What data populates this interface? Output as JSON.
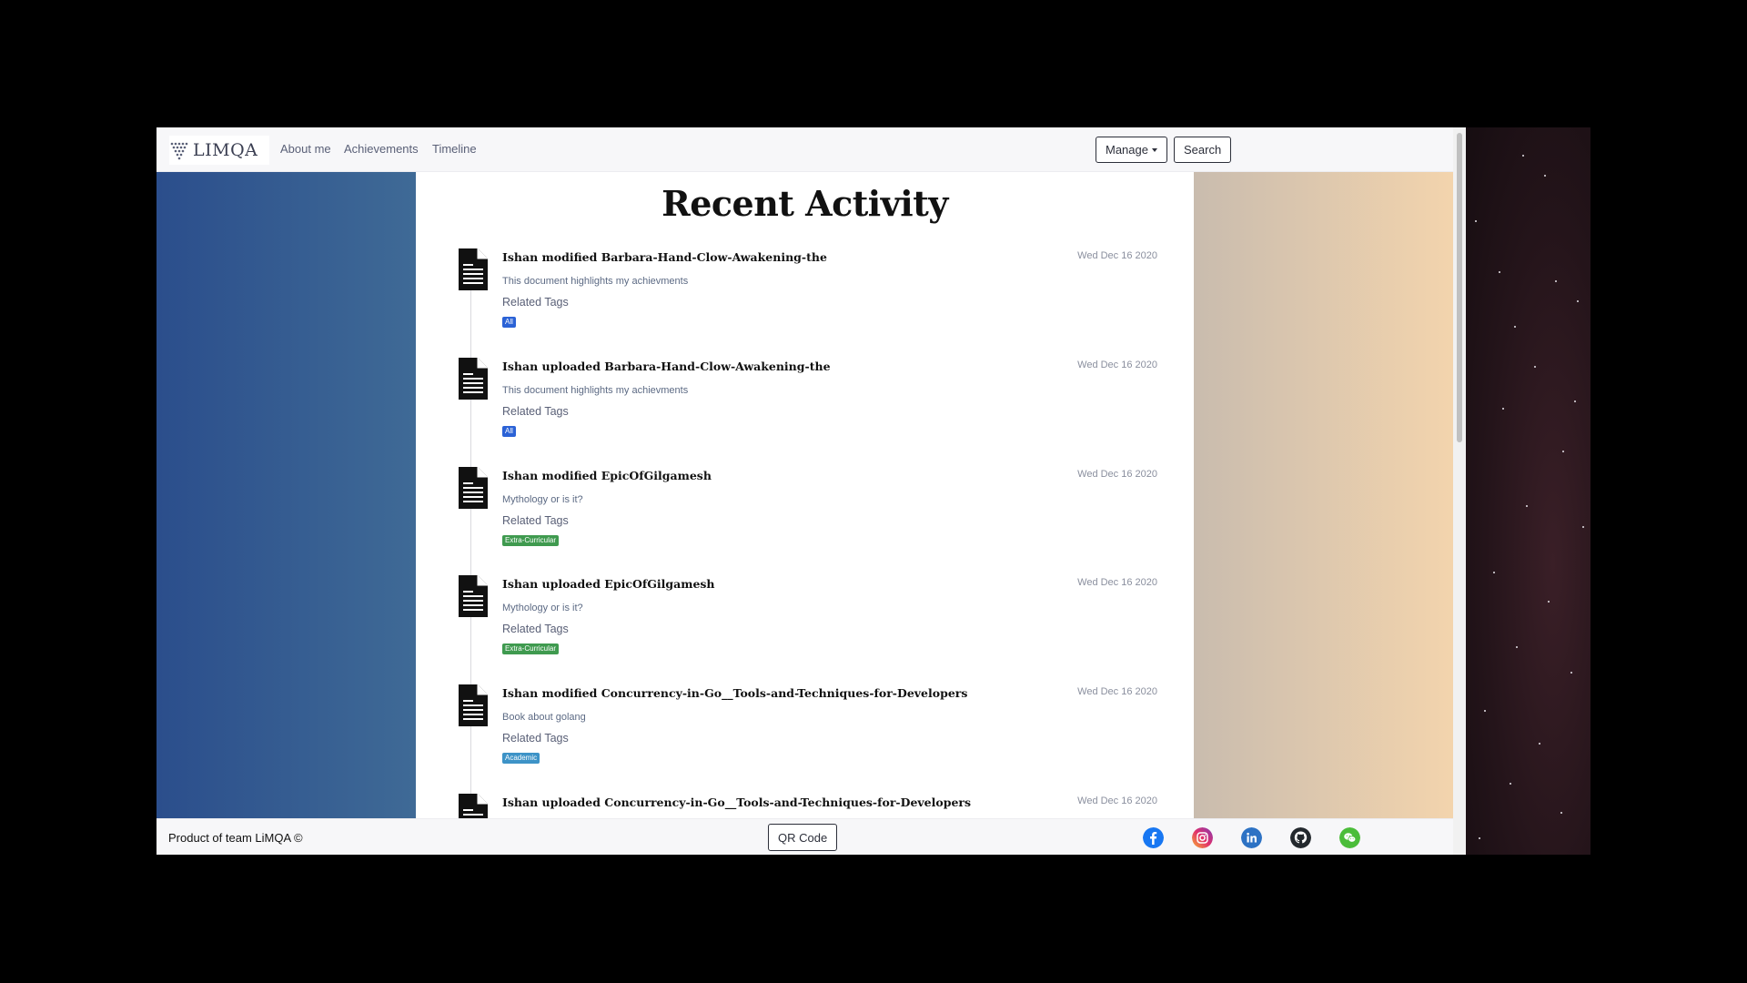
{
  "navbar": {
    "logo_text": "LIMQA",
    "links": [
      "About me",
      "Achievements",
      "Timeline"
    ],
    "manage_label": "Manage",
    "search_label": "Search"
  },
  "main": {
    "title": "Recent Activity",
    "related_tags_label": "Related Tags",
    "activities": [
      {
        "title": "Ishan modified Barbara-Hand-Clow-Awakening-the",
        "date": "Wed Dec 16 2020",
        "description": "This document highlights my achievments",
        "tag": "All",
        "tag_color": "#2b62d6"
      },
      {
        "title": "Ishan uploaded Barbara-Hand-Clow-Awakening-the",
        "date": "Wed Dec 16 2020",
        "description": "This document highlights my achievments",
        "tag": "All",
        "tag_color": "#2b62d6"
      },
      {
        "title": "Ishan modified EpicOfGilgamesh",
        "date": "Wed Dec 16 2020",
        "description": "Mythology or is it?",
        "tag": "Extra-Curricular",
        "tag_color": "#3f9a4f"
      },
      {
        "title": "Ishan uploaded EpicOfGilgamesh",
        "date": "Wed Dec 16 2020",
        "description": "Mythology or is it?",
        "tag": "Extra-Curricular",
        "tag_color": "#3f9a4f"
      },
      {
        "title": "Ishan modified Concurrency-in-Go__Tools-and-Techniques-for-Developers",
        "date": "Wed Dec 16 2020",
        "description": "Book about golang",
        "tag": "Academic",
        "tag_color": "#3d93c7"
      },
      {
        "title": "Ishan uploaded Concurrency-in-Go__Tools-and-Techniques-for-Developers",
        "date": "Wed Dec 16 2020",
        "description": "",
        "tag": "",
        "tag_color": ""
      }
    ]
  },
  "footer": {
    "text": "Product of team LiMQA ©",
    "qr_label": "QR Code",
    "social_icons": [
      "facebook-icon",
      "instagram-icon",
      "linkedin-icon",
      "github-icon",
      "wechat-icon"
    ]
  }
}
